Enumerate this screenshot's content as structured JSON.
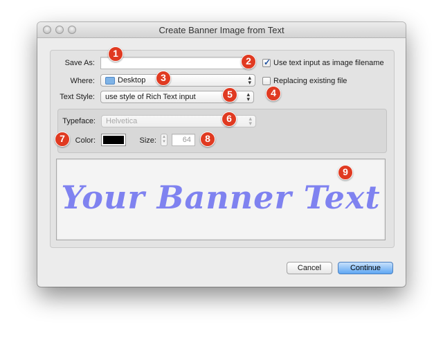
{
  "window": {
    "title": "Create Banner Image from Text"
  },
  "form": {
    "save_as_label": "Save As:",
    "save_as_value": "",
    "use_input_filename_label": "Use text input as image filename",
    "use_input_filename_checked": true,
    "where_label": "Where:",
    "where_value": "Desktop",
    "replacing_label": "Replacing existing file",
    "replacing_checked": false,
    "text_style_label": "Text Style:",
    "text_style_value": "use style of Rich Text input"
  },
  "typeface": {
    "typeface_label": "Typeface:",
    "typeface_value": "Helvetica",
    "color_label": "Color:",
    "color_value": "#000000",
    "size_label": "Size:",
    "size_value": "64"
  },
  "preview": {
    "banner_text": "Your Banner Text",
    "banner_color": "#7f82f0"
  },
  "buttons": {
    "cancel": "Cancel",
    "continue": "Continue"
  },
  "callouts": [
    "1",
    "2",
    "3",
    "4",
    "5",
    "6",
    "7",
    "8",
    "9"
  ],
  "colors": {
    "callout": "#e03a21",
    "default_button": "#5fa7f3"
  }
}
